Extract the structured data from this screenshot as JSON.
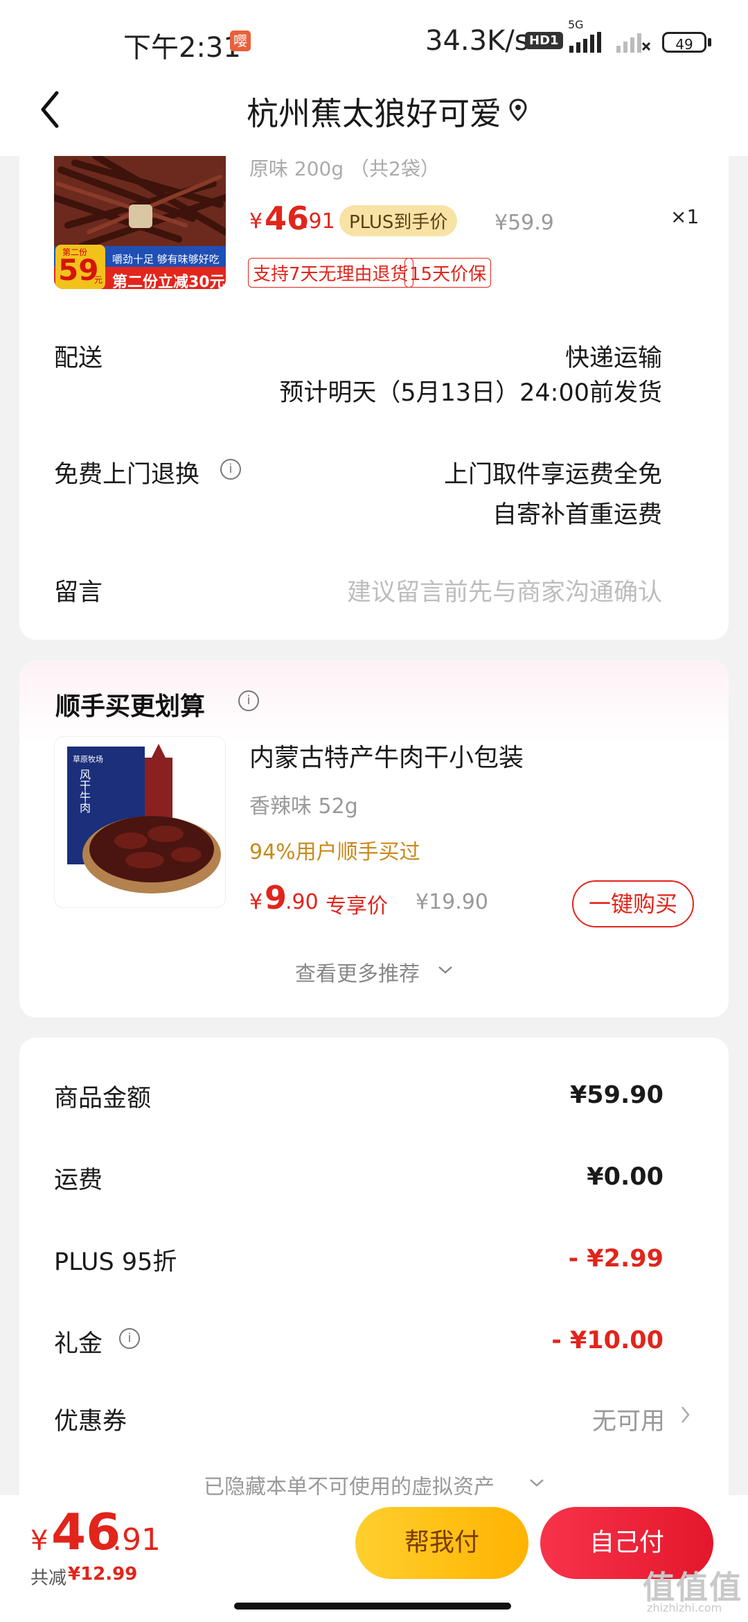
{
  "status_bar": {
    "time": "下午2:31",
    "notif_glyph": "嘤",
    "net_speed": "34.3K/s",
    "hd_badge": "HD1",
    "signal_label": "5G",
    "battery": "49"
  },
  "header": {
    "title": "杭州蕉太狼好可爱"
  },
  "order_item": {
    "image_text_top": "第二份",
    "image_price": "59",
    "image_price_unit": "元",
    "image_slogan": "嚼劲十足 够有味够好吃",
    "image_banner": "第二份立减30元",
    "variant": "原味 200g （共2袋）",
    "currency": "¥",
    "price_int": "46",
    "price_dec": ".91",
    "plus_badge": "PLUS到手价",
    "original_price": "¥59.9",
    "quantity": "×1",
    "tags": [
      "支持7天无理由退货",
      "15天价保"
    ]
  },
  "delivery": {
    "label": "配送",
    "method": "快递运输",
    "eta": "预计明天（5月13日）24:00前发货"
  },
  "return_service": {
    "label": "免费上门退换",
    "line1": "上门取件享运费全免",
    "line2": "自寄补首重运费"
  },
  "message": {
    "label": "留言",
    "placeholder": "建议留言前先与商家沟通确认"
  },
  "addon": {
    "section_title": "顺手买更划算",
    "image_text": "风干牛肉",
    "image_brand": "草原牧场",
    "name": "内蒙古特产牛肉干小包装",
    "variant": "香辣味 52g",
    "social_proof": "94%用户顺手买过",
    "currency": "¥",
    "price_int": "9",
    "price_dec": ".90",
    "price_label": "专享价",
    "original_price": "¥19.90",
    "buy_button": "一键购买",
    "more": "查看更多推荐"
  },
  "summary": {
    "rows": [
      {
        "label": "商品金额",
        "value": "¥59.90"
      },
      {
        "label": "运费",
        "value": "¥0.00"
      },
      {
        "label": "PLUS 95折",
        "value": "- ¥2.99"
      },
      {
        "label": "礼金",
        "value": "- ¥10.00"
      },
      {
        "label": "优惠券",
        "value": "无可用"
      }
    ],
    "hidden_assets": "已隐藏本单不可使用的虚拟资产"
  },
  "bottom": {
    "currency": "¥",
    "total_int": "46",
    "total_dec": ".91",
    "saved_label": "共减",
    "saved_value": "¥12.99",
    "help_pay": "帮我付",
    "self_pay": "自己付"
  },
  "watermark": {
    "main": "值值值",
    "sub": "zhizhizhi.com"
  },
  "colors": {
    "accent_red": "#e1251b",
    "plus_gold": "#f8e3a6",
    "pay_yellow": "#ffc21a",
    "pay_red": "#ee2238"
  }
}
